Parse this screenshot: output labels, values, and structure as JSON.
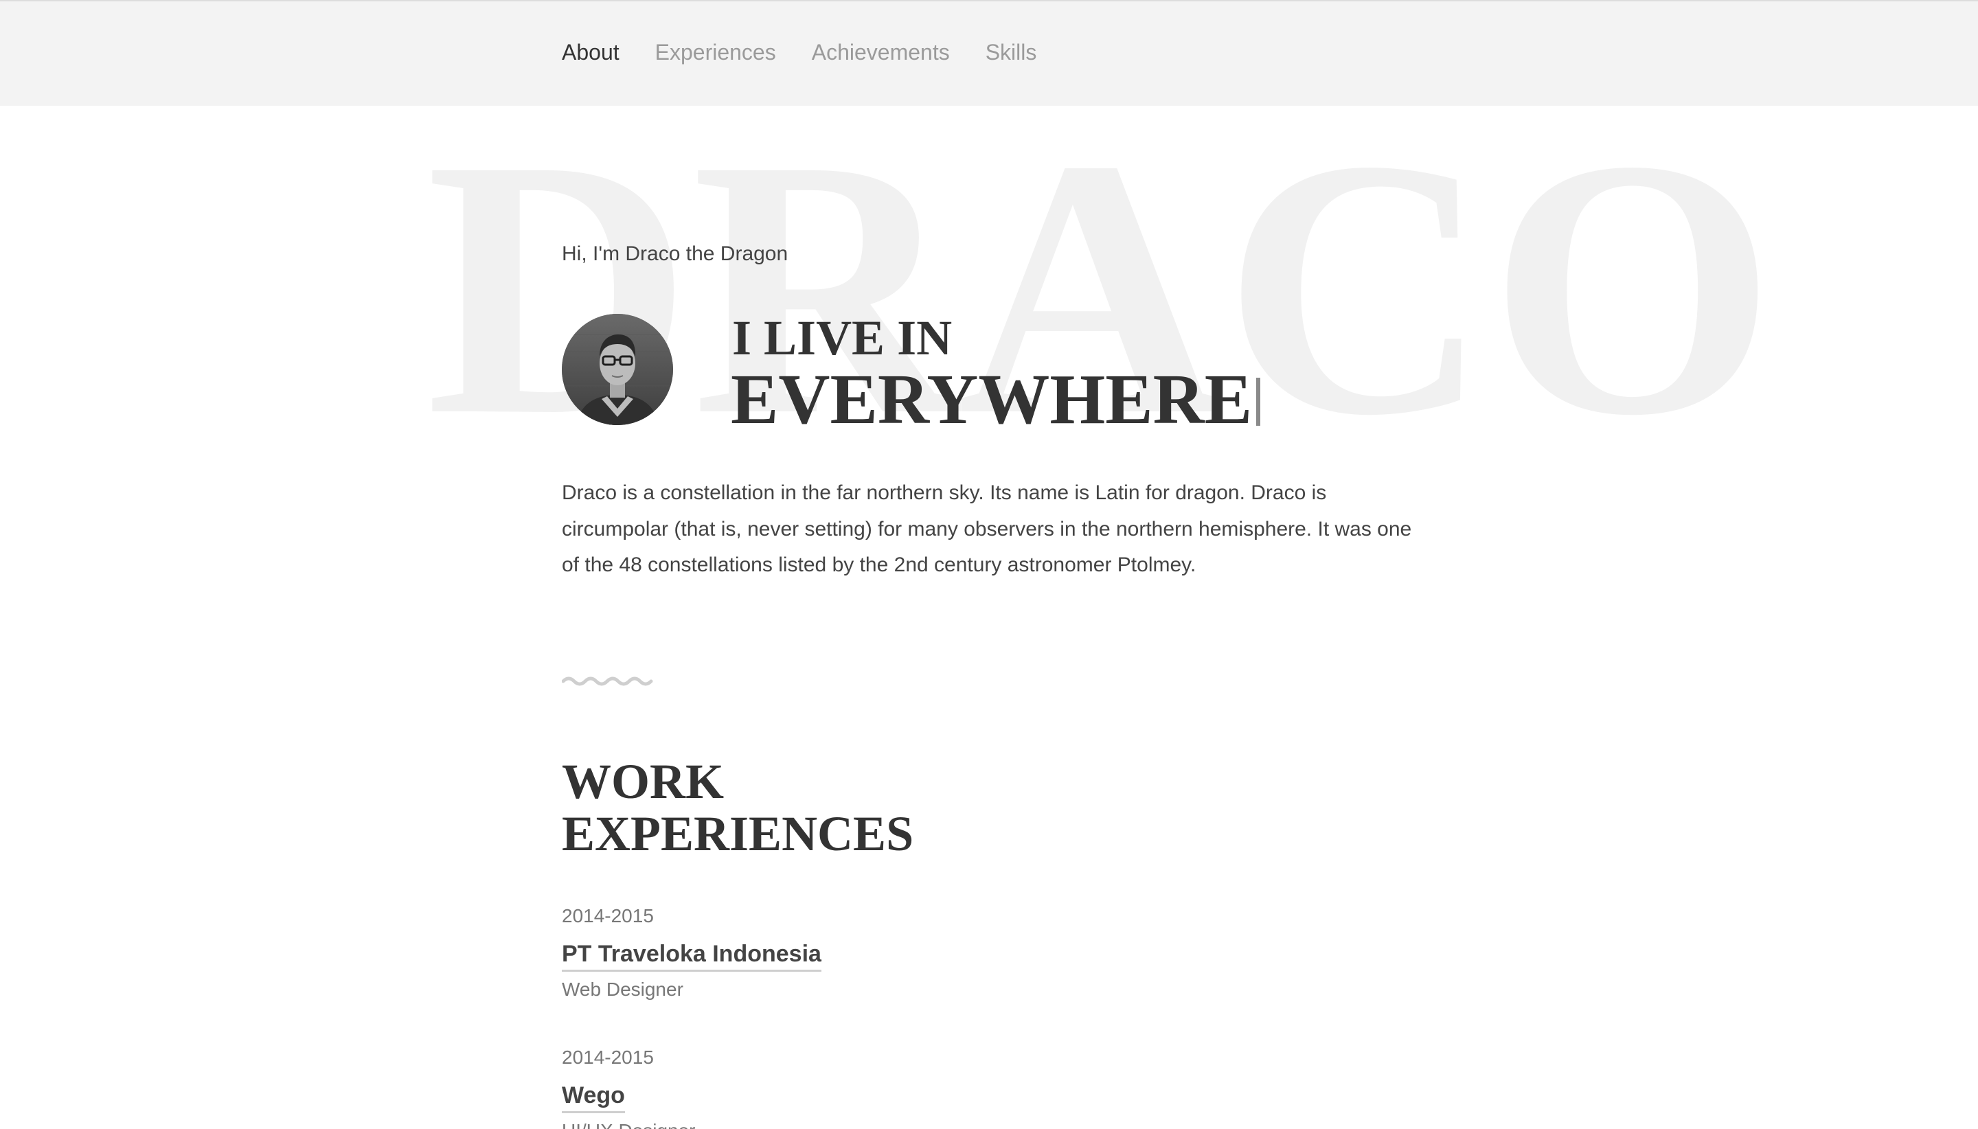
{
  "nav": {
    "items": [
      {
        "label": "About",
        "active": true
      },
      {
        "label": "Experiences",
        "active": false
      },
      {
        "label": "Achievements",
        "active": false
      },
      {
        "label": "Skills",
        "active": false
      }
    ]
  },
  "hero": {
    "background_word": "DRACO",
    "greeting": "Hi, I'm Draco the Dragon",
    "live_label": "I LIVE IN",
    "live_place": "EVERYWHERE"
  },
  "about": {
    "bio": "Draco is a constellation in the far northern sky. Its name is Latin for dragon. Draco is circumpolar (that is, never setting) for many observers in the northern hemisphere. It was one of the 48 constellations listed by the 2nd century astronomer Ptolmey."
  },
  "work": {
    "title_line1": "WORK",
    "title_line2": "EXPERIENCES",
    "items": [
      {
        "years": "2014-2015",
        "company": "PT Traveloka Indonesia",
        "role": "Web Designer"
      },
      {
        "years": "2014-2015",
        "company": "Wego",
        "role": "UI/UX Designer"
      }
    ]
  },
  "colors": {
    "nav_bg": "#f3f3f3",
    "text_dark": "#333333",
    "text_muted": "#9a9a9a",
    "background_word": "#f1f1f1"
  }
}
